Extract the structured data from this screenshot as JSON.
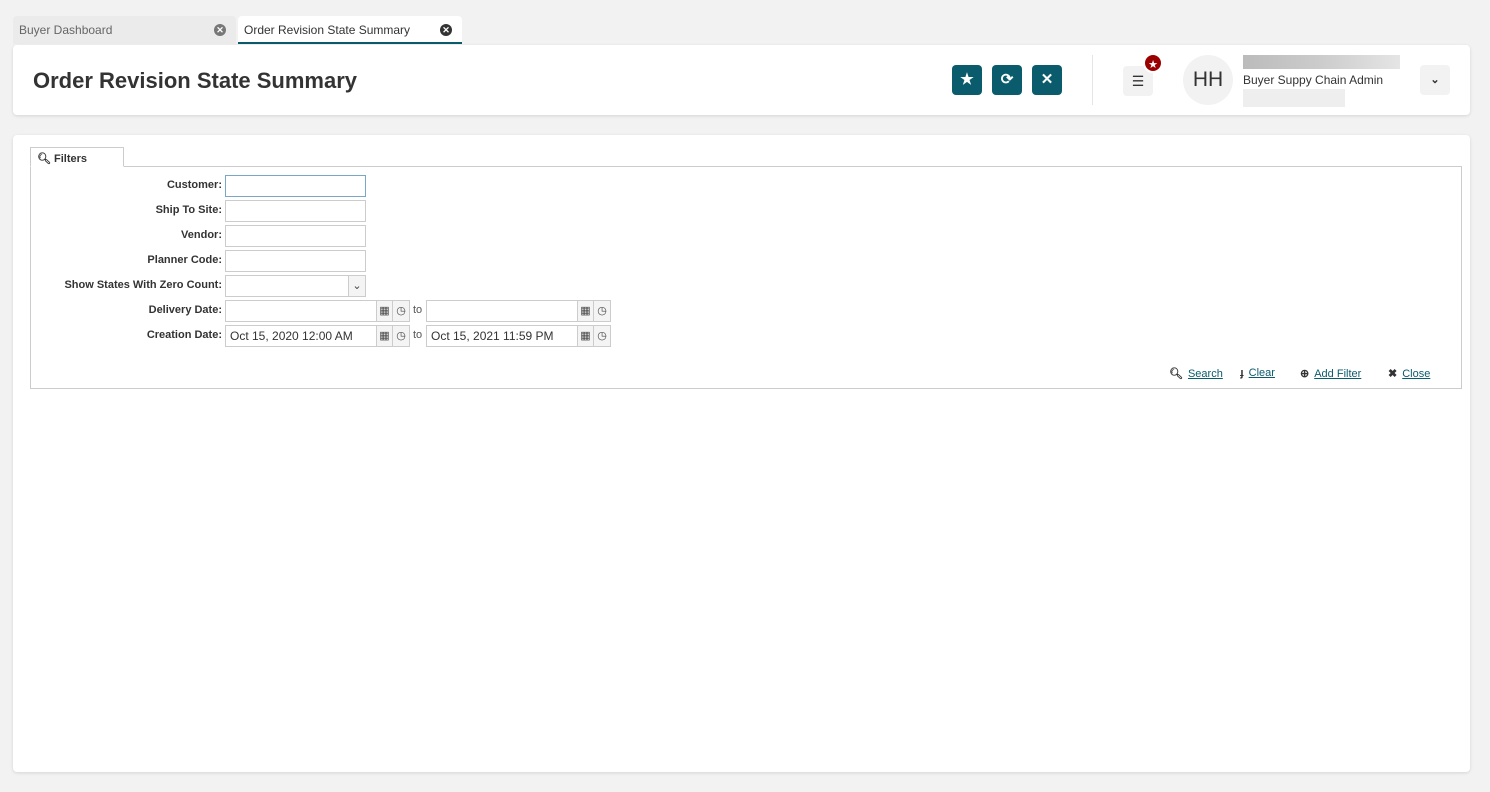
{
  "tabs": [
    {
      "label": "Buyer Dashboard",
      "active": false
    },
    {
      "label": "Order Revision State Summary",
      "active": true
    }
  ],
  "header": {
    "title": "Order Revision State Summary",
    "user_initials": "HH",
    "user_role": "Buyer Suppy Chain Admin"
  },
  "colors": {
    "accent": "#0a5b6c",
    "badge": "#9b0000"
  },
  "filters": {
    "tab_label": "Filters",
    "fields": [
      {
        "label": "Customer:",
        "value": ""
      },
      {
        "label": "Ship To Site:",
        "value": ""
      },
      {
        "label": "Vendor:",
        "value": ""
      },
      {
        "label": "Planner Code:",
        "value": ""
      },
      {
        "label": "Show States With Zero Count:",
        "value": ""
      },
      {
        "label": "Delivery Date:",
        "from": "",
        "to": ""
      },
      {
        "label": "Creation Date:",
        "from": "Oct 15, 2020 12:00 AM",
        "to": "Oct 15, 2021 11:59 PM"
      }
    ],
    "to_label": "to",
    "actions": {
      "search": "Search",
      "clear": "Clear",
      "add_filter": "Add Filter",
      "close": "Close"
    }
  }
}
